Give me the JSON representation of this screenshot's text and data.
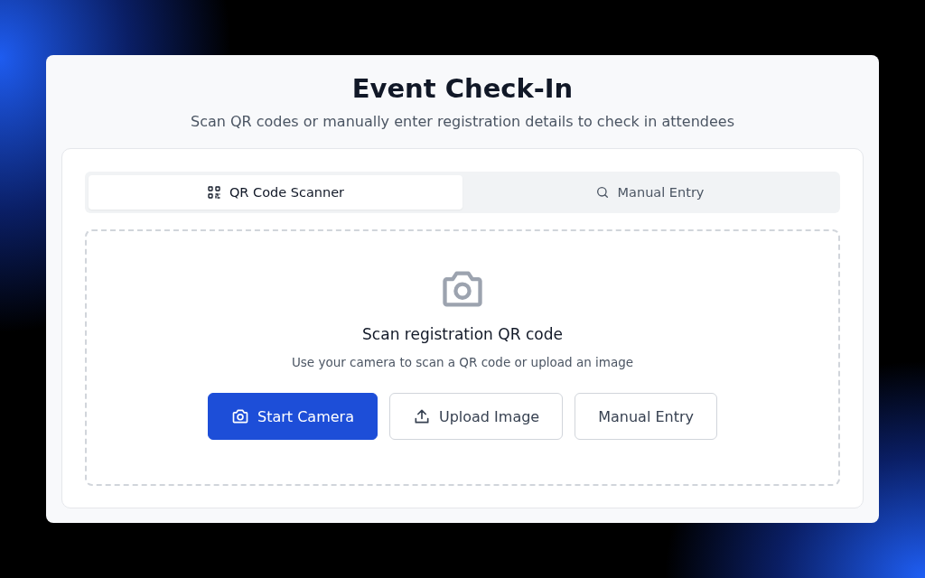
{
  "title": "Event Check-In",
  "subtitle": "Scan QR codes or manually enter registration details to check in attendees",
  "tabs": [
    {
      "label": "QR Code Scanner",
      "selected": true
    },
    {
      "label": "Manual Entry",
      "selected": false
    }
  ],
  "scanner": {
    "heading": "Scan registration QR code",
    "hint": "Use your camera to scan a QR code or upload an image"
  },
  "buttons": [
    {
      "label": "Start Camera",
      "kind": "primary"
    },
    {
      "label": "Upload Image",
      "kind": "outline"
    },
    {
      "label": "Manual Entry",
      "kind": "outline"
    }
  ]
}
